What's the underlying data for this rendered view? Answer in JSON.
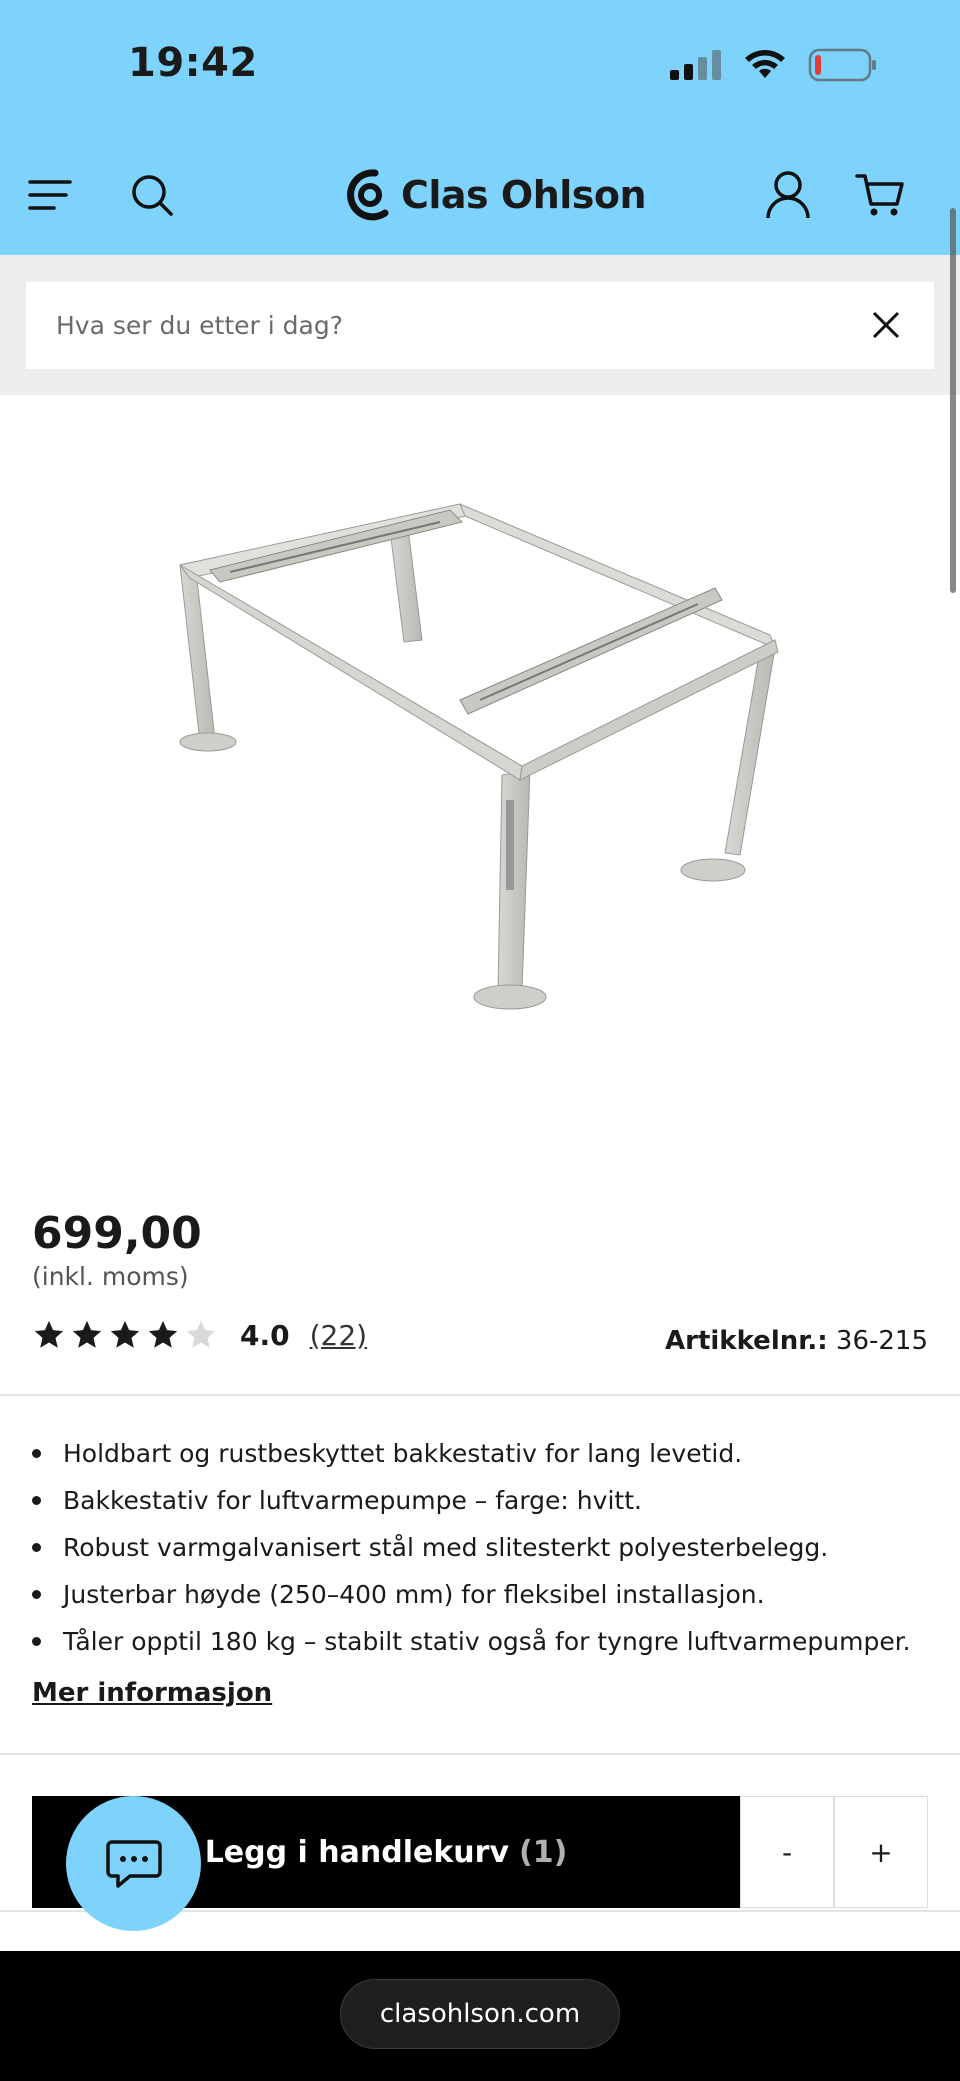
{
  "status_bar": {
    "time": "19:42"
  },
  "header": {
    "brand": "Clas Ohlson"
  },
  "search": {
    "placeholder": "Hva ser du etter i dag?"
  },
  "product": {
    "price": "699,00",
    "vat_note": "(inkl. moms)",
    "rating_value": "4.0",
    "rating_stars": 4,
    "rating_max": 5,
    "review_count": "(22)",
    "article_label": "Artikkelnr.:",
    "article_number": "36-215",
    "features": [
      "Holdbart og rustbeskyttet bakkestativ for lang levetid.",
      "Bakkestativ for luftvarmepumpe – farge: hvitt.",
      "Robust varmgalvanisert stål med slitesterkt polyesterbelegg.",
      "Justerbar høyde (250–400 mm) for fleksibel installasjon.",
      "Tåler opptil 180 kg – stabilt stativ også for tyngre luftvarmepumper."
    ],
    "more_info": "Mer informasjon"
  },
  "cart": {
    "add_label": "Legg i handlekurv",
    "count": "(1)",
    "minus": "-",
    "plus": "+"
  },
  "browser": {
    "url": "clasohlson.com"
  },
  "colors": {
    "brand_blue": "#7dd3fb",
    "black": "#000000",
    "star": "#1a1a1a"
  }
}
